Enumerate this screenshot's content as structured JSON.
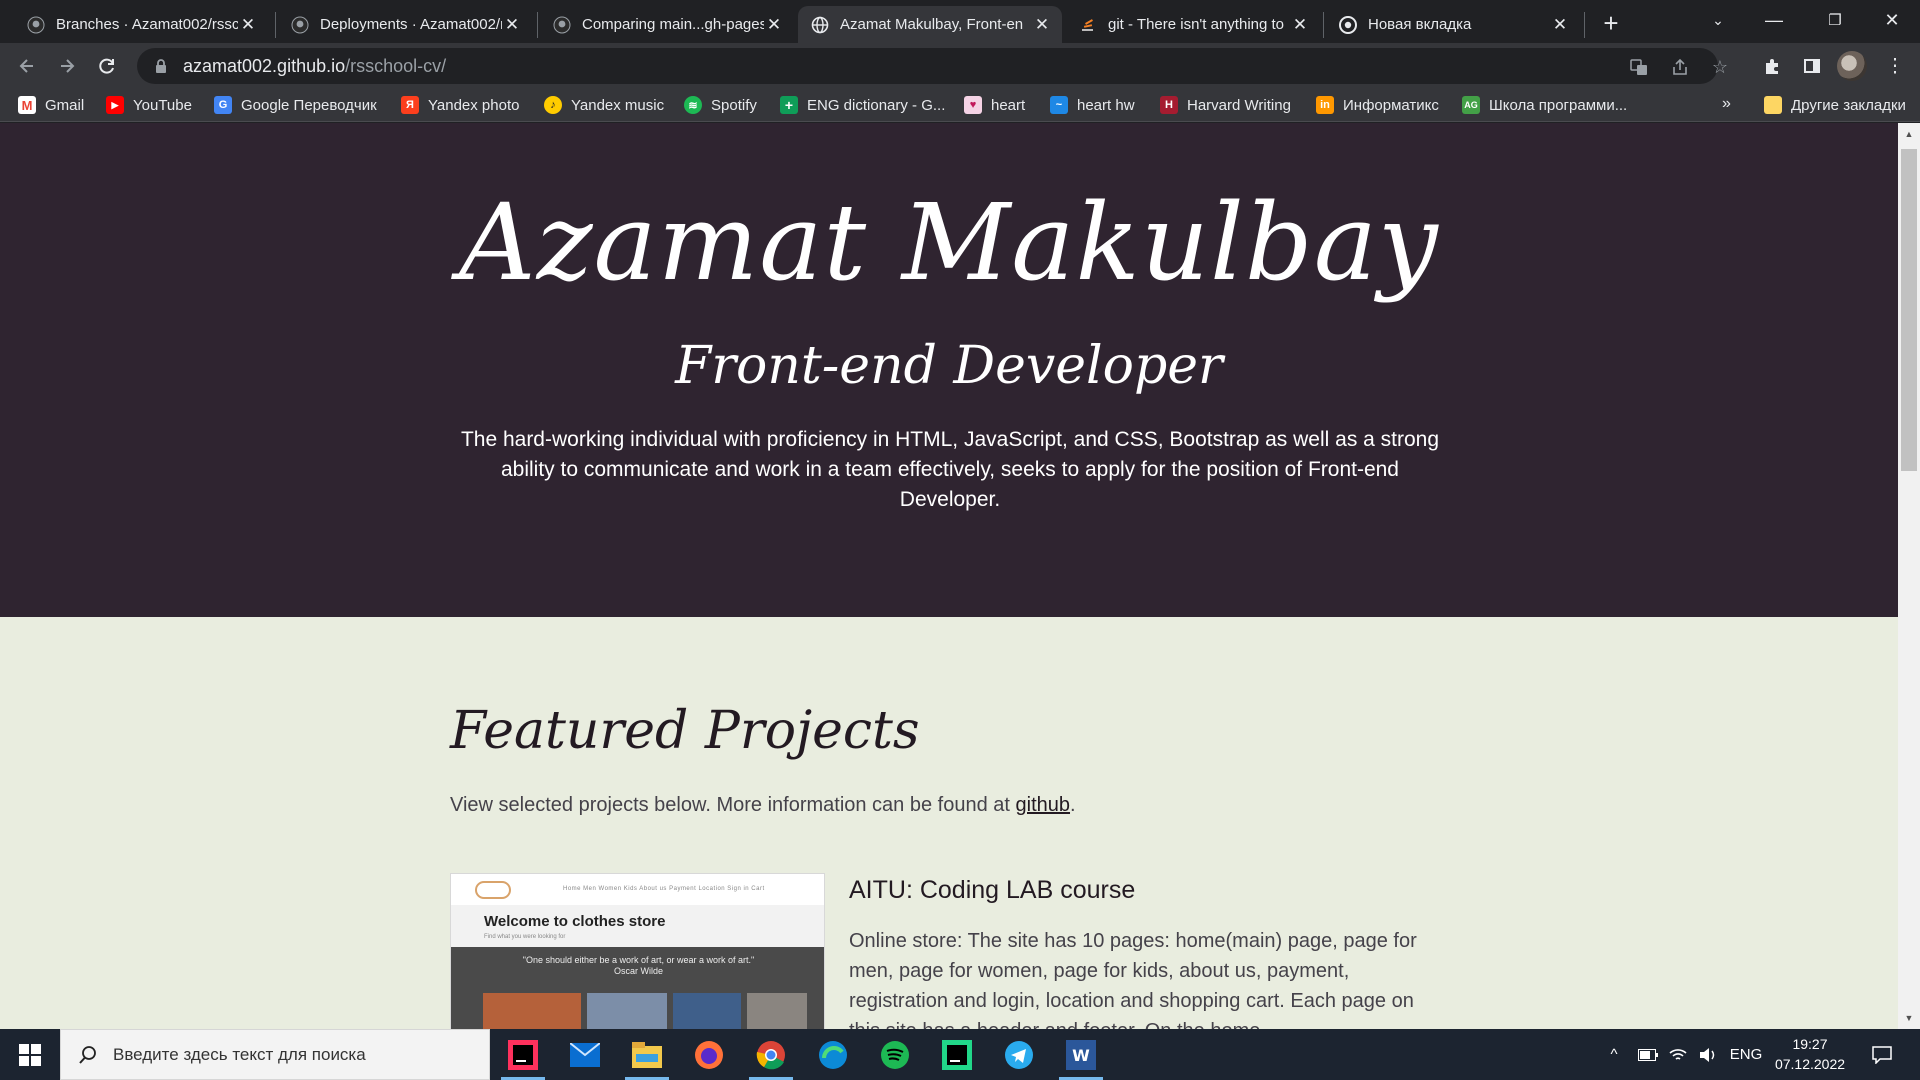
{
  "browser": {
    "tabs": [
      {
        "title": "Branches · Azamat002/rssch",
        "icon": "github-icon",
        "active": false
      },
      {
        "title": "Deployments · Azamat002/r",
        "icon": "github-icon",
        "active": false
      },
      {
        "title": "Comparing main...gh-pages",
        "icon": "github-icon",
        "active": false
      },
      {
        "title": "Azamat Makulbay, Front-en",
        "icon": "globe-icon",
        "active": true
      },
      {
        "title": "git - There isn't anything to",
        "icon": "stackoverflow-icon",
        "active": false
      },
      {
        "title": "Новая вкладка",
        "icon": "chrome-icon",
        "active": false
      }
    ],
    "url_host": "azamat002.github.io",
    "url_path": "/rsschool-cv/",
    "bookmarks": [
      {
        "label": "Gmail",
        "icon": "gmail-icon",
        "color": "#ea4335"
      },
      {
        "label": "YouTube",
        "icon": "youtube-icon",
        "color": "#ff0000"
      },
      {
        "label": "Google Переводчик",
        "icon": "google-translate-icon",
        "color": "#4285f4"
      },
      {
        "label": "Yandex photo",
        "icon": "yandex-photo-icon",
        "color": "#fc3f1d"
      },
      {
        "label": "Yandex music",
        "icon": "yandex-music-icon",
        "color": "#ffcc00"
      },
      {
        "label": "Spotify",
        "icon": "spotify-icon",
        "color": "#1db954"
      },
      {
        "label": "ENG dictionary - G...",
        "icon": "sheets-plus-icon",
        "color": "#0f9d58"
      },
      {
        "label": "heart",
        "icon": "heart-page-icon",
        "color": "#e91e63"
      },
      {
        "label": "heart hw",
        "icon": "heart-hw-icon",
        "color": "#1e88e5"
      },
      {
        "label": "Harvard Writing",
        "icon": "harvard-icon",
        "color": "#a51c30"
      },
      {
        "label": "Информатикс",
        "icon": "informatics-icon",
        "color": "#ff9800"
      },
      {
        "label": "Школа программи...",
        "icon": "school-icon",
        "color": "#43a047"
      }
    ],
    "other_bookmarks": "Другие закладки",
    "more": "»"
  },
  "page": {
    "name": "Azamat Makulbay",
    "role": "Front-end Developer",
    "summary": "The hard-working individual with proficiency in HTML, JavaScript, and CSS, Bootstrap as well as a strong ability to communicate and work in a team effectively, seeks to apply for the position of Front-end Developer.",
    "featured": {
      "heading": "Featured Projects",
      "intro_text": "View selected projects below. More information can be found at ",
      "intro_link": "github",
      "intro_end": "."
    },
    "project": {
      "title": "AITU: Coding LAB course",
      "description": "Online store: The site has 10 pages: home(main) page, page for men, page for women, page for kids, about us, payment, registration and login, location and shopping cart. Each page on this site has a header and footer. On the home",
      "thumbnail": {
        "heading": "Welcome to clothes store",
        "sub": "Find what you were looking for",
        "quote": "\"One should either be a work of art, or wear a work of art.\"",
        "author": "Oscar Wilde",
        "nav": "Home   Men   Women   Kids   About us   Payment   Location   Sign in   Cart"
      }
    }
  },
  "taskbar": {
    "search_placeholder": "Введите здесь текст для поиска",
    "apps": [
      "intellij-icon",
      "mail-icon",
      "file-explorer-icon",
      "firefox-icon",
      "chrome-icon",
      "edge-icon",
      "spotify-icon",
      "pycharm-icon",
      "telegram-icon",
      "word-icon"
    ],
    "language": "ENG",
    "time": "19:27",
    "date": "07.12.2022"
  }
}
